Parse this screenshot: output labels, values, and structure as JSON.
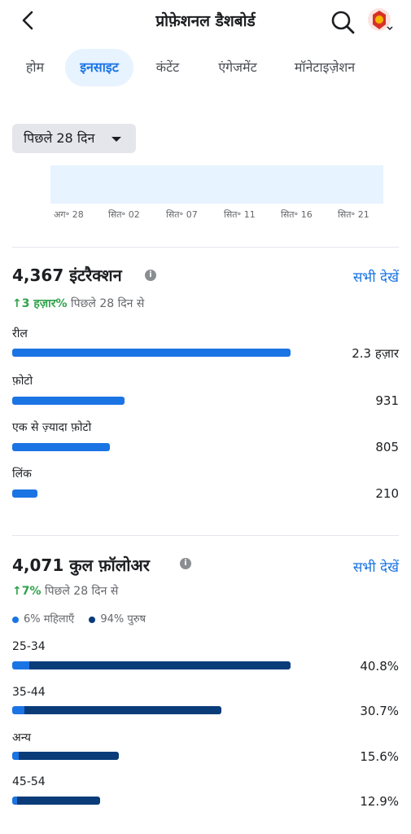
{
  "header": {
    "title": "प्रोफ़ेशनल डैशबोर्ड"
  },
  "tabs": [
    {
      "label": "होम"
    },
    {
      "label": "इनसाइट",
      "active": true
    },
    {
      "label": "कंटेंट"
    },
    {
      "label": "एंगेजमेंट"
    },
    {
      "label": "मॉनेटाइज़ेशन"
    }
  ],
  "date_filter": {
    "selected": "पिछले 28 दिन"
  },
  "timeline": {
    "ticks": [
      "अग॰ 28",
      "सित॰ 02",
      "सित॰ 07",
      "सित॰ 11",
      "सित॰ 16",
      "सित॰ 21"
    ]
  },
  "interactions": {
    "total_text": "4,367 इंटरैक्शन",
    "see_all": "सभी देखें",
    "delta_value": "↑3 हज़ार%",
    "delta_suffix": " पिछले 28 दिन से",
    "rows": [
      {
        "label": "रील",
        "value_text": "2.3 हज़ार",
        "value": 2300
      },
      {
        "label": "फ़ोटो",
        "value_text": "931",
        "value": 931
      },
      {
        "label": "एक से ज़्यादा फ़ोटो",
        "value_text": "805",
        "value": 805
      },
      {
        "label": "लिंक",
        "value_text": "210",
        "value": 210
      }
    ]
  },
  "followers": {
    "total_text": "4,071 कुल फ़ॉलोअर",
    "see_all": "सभी देखें",
    "delta_value": "↑7%",
    "delta_suffix": " पिछले 28 दिन से",
    "legend": [
      {
        "text": "6% महिलाएँ",
        "color": "#1b74e4"
      },
      {
        "text": "94% पुरुष",
        "color": "#0a3c7a"
      }
    ],
    "age_rows": [
      {
        "label": "25-34",
        "value_text": "40.8%",
        "value": 40.8
      },
      {
        "label": "35-44",
        "value_text": "30.7%",
        "value": 30.7
      },
      {
        "label": "अन्य",
        "value_text": "15.6%",
        "value": 15.6
      },
      {
        "label": "45-54",
        "value_text": "12.9%",
        "value": 12.9
      }
    ]
  },
  "colors": {
    "accent": "#1b74e4",
    "dark_blue": "#0a3c7a",
    "positive": "#31a24c"
  }
}
